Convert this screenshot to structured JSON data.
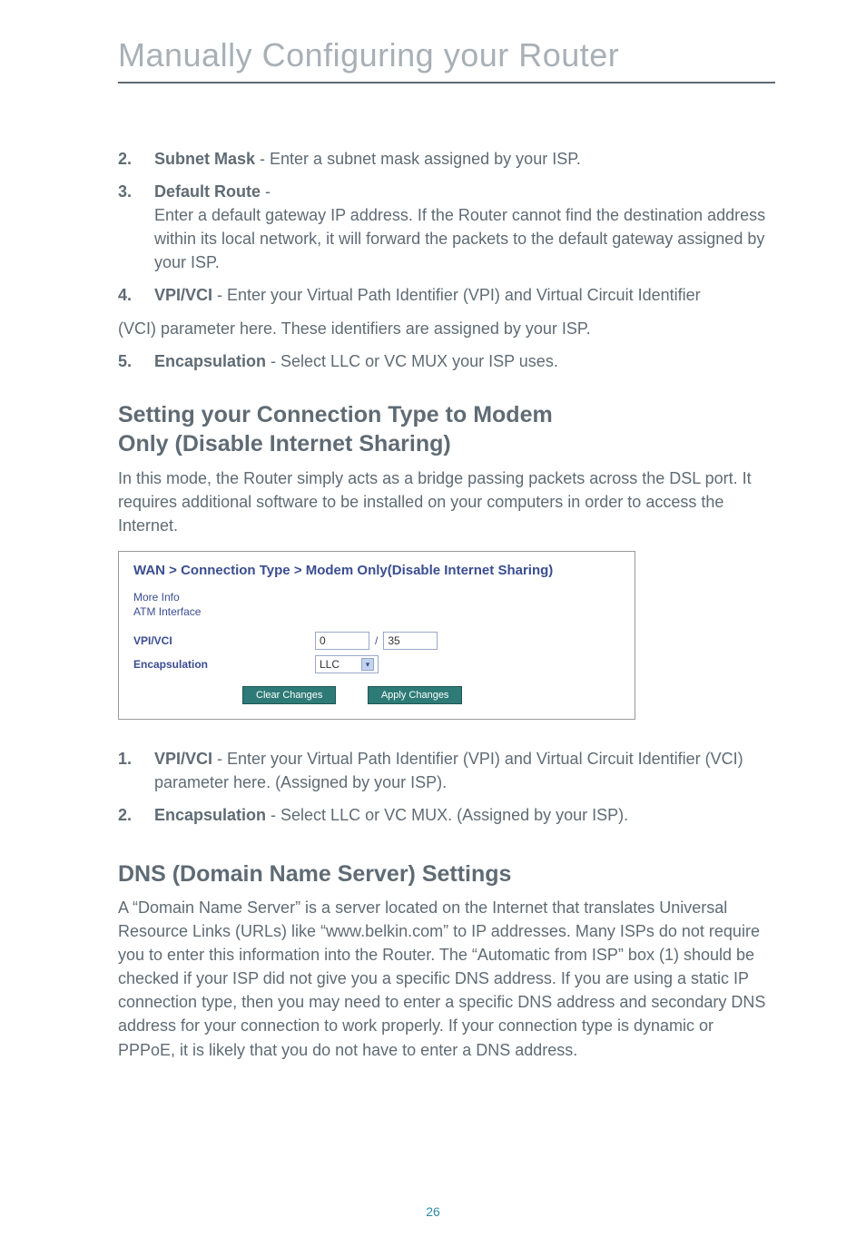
{
  "page_title": "Manually Configuring your Router",
  "items_top": [
    {
      "num": "2.",
      "label": "Subnet Mask",
      "text": " - Enter a subnet mask assigned by your ISP."
    },
    {
      "num": "3.",
      "label": "Default Route",
      "text": " -",
      "extra": "Enter a default gateway IP address. If the Router cannot find the destination address within its local network, it will forward the packets to the default gateway assigned by your ISP."
    },
    {
      "num": "4.",
      "label": "VPI/VCI",
      "text": " - Enter your Virtual Path Identifier (VPI) and Virtual Circuit Identifier"
    }
  ],
  "vci_line": "(VCI) parameter here. These identifiers are assigned by your ISP.",
  "item5": {
    "num": "5.",
    "label": "Encapsulation",
    "text": " - Select LLC or VC MUX your ISP uses."
  },
  "heading1_line1": "Setting your Connection Type to Modem",
  "heading1_line2": "Only (Disable Internet Sharing)",
  "heading1_para": "In this mode, the Router simply acts as a bridge passing packets across the DSL port. It requires additional software to be installed on your computers in order to access the Internet.",
  "screenshot": {
    "title": "WAN > Connection Type > Modem Only(Disable Internet Sharing)",
    "more_info": "More Info",
    "atm_interface": "ATM Interface",
    "vpi_vci_label": "VPI/VCI",
    "vpi_value": "0",
    "vci_value": "35",
    "encap_label": "Encapsulation",
    "encap_value": "LLC",
    "btn_clear": "Clear Changes",
    "btn_apply": "Apply Changes"
  },
  "items_mid": [
    {
      "num": "1.",
      "label": "VPI/VCI",
      "text": " - Enter your Virtual Path Identifier (VPI) and Virtual Circuit Identifier (VCI) parameter here. (Assigned by your ISP)."
    },
    {
      "num": "2.",
      "label": "Encapsulation",
      "text": " - Select LLC or VC MUX. (Assigned by your ISP)."
    }
  ],
  "heading2": "DNS (Domain Name Server) Settings",
  "heading2_para": "A “Domain Name Server” is a server located on the Internet that translates Universal Resource Links (URLs) like “www.belkin.com” to IP addresses. Many ISPs do not require you to enter this information into the Router. The “Automatic from ISP” box (1) should be checked if your ISP did not give you a specific DNS address. If you are using a static IP connection type, then you may need to enter a specific DNS address and secondary DNS address for your connection to work properly. If your connection type is dynamic or PPPoE, it is likely that you do not have to enter a DNS address.",
  "page_number": "26"
}
